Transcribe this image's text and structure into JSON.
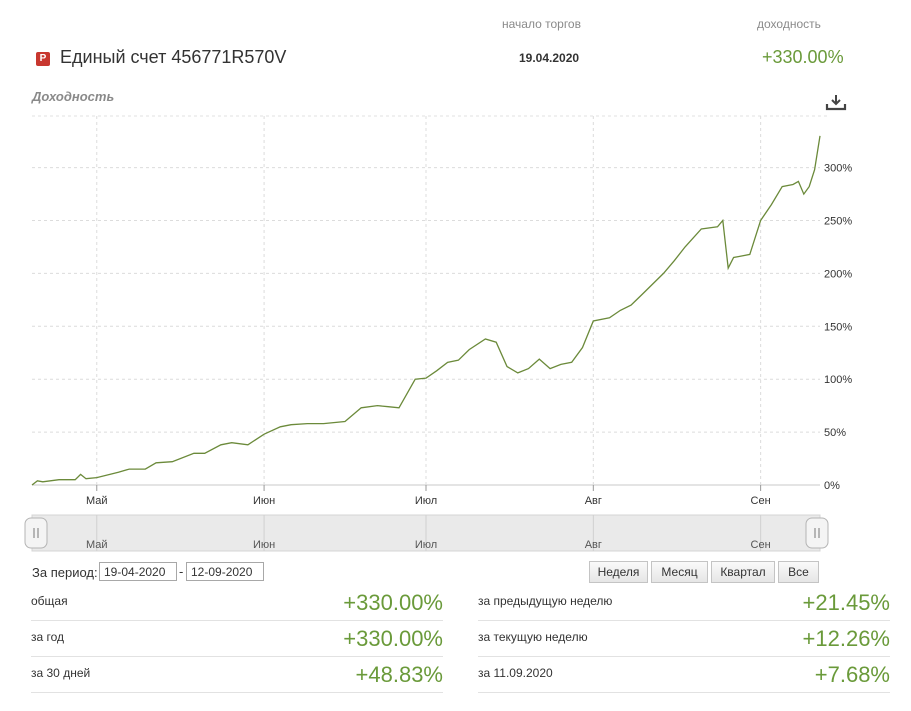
{
  "header": {
    "start_label": "начало торгов",
    "yield_label": "доходность",
    "badge": "P",
    "account_title": "Единый счет 456771R570V",
    "start_date": "19.04.2020",
    "total_yield": "+330.00%"
  },
  "chart_title": "Доходность",
  "download_icon": "download-icon",
  "chart_data": {
    "type": "line",
    "title": "Доходность",
    "x_labels": [
      "Май",
      "Июн",
      "Июл",
      "Авг",
      "Сен"
    ],
    "x_label_dates": [
      "2020-05-01",
      "2020-06-01",
      "2020-07-01",
      "2020-08-01",
      "2020-09-01"
    ],
    "x_range": [
      "2020-04-19",
      "2020-09-12"
    ],
    "y_ticks": [
      0,
      50,
      100,
      150,
      200,
      250,
      300
    ],
    "y_tick_labels": [
      "0%",
      "50%",
      "100%",
      "150%",
      "200%",
      "250%",
      "300%"
    ],
    "ylim": [
      0,
      350
    ],
    "grid": true,
    "line_color": "#6b8a3a",
    "series": [
      {
        "x": [
          "2020-04-19",
          "2020-04-20",
          "2020-04-21",
          "2020-04-24",
          "2020-04-27",
          "2020-04-28",
          "2020-04-29",
          "2020-05-01",
          "2020-05-05",
          "2020-05-07",
          "2020-05-10",
          "2020-05-12",
          "2020-05-15",
          "2020-05-19",
          "2020-05-21",
          "2020-05-24",
          "2020-05-26",
          "2020-05-29",
          "2020-06-01",
          "2020-06-04",
          "2020-06-06",
          "2020-06-09",
          "2020-06-12",
          "2020-06-16",
          "2020-06-19",
          "2020-06-22",
          "2020-06-24",
          "2020-06-26",
          "2020-06-29",
          "2020-07-01",
          "2020-07-03",
          "2020-07-05",
          "2020-07-07",
          "2020-07-09",
          "2020-07-12",
          "2020-07-14",
          "2020-07-16",
          "2020-07-18",
          "2020-07-20",
          "2020-07-22",
          "2020-07-24",
          "2020-07-26",
          "2020-07-28",
          "2020-07-30",
          "2020-08-01",
          "2020-08-04",
          "2020-08-06",
          "2020-08-08",
          "2020-08-10",
          "2020-08-12",
          "2020-08-14",
          "2020-08-16",
          "2020-08-18",
          "2020-08-21",
          "2020-08-24",
          "2020-08-25",
          "2020-08-26",
          "2020-08-27",
          "2020-08-28",
          "2020-08-30",
          "2020-09-01",
          "2020-09-03",
          "2020-09-05",
          "2020-09-07",
          "2020-09-08",
          "2020-09-09",
          "2020-09-10",
          "2020-09-11",
          "2020-09-12"
        ],
        "values": [
          0,
          4,
          3,
          5,
          5,
          10,
          6,
          7,
          12,
          15,
          15,
          21,
          22,
          30,
          30,
          38,
          40,
          38,
          48,
          55,
          57,
          58,
          58,
          60,
          73,
          75,
          74,
          73,
          100,
          101,
          108,
          116,
          118,
          128,
          138,
          135,
          112,
          106,
          110,
          119,
          110,
          114,
          116,
          130,
          155,
          158,
          165,
          170,
          180,
          190,
          200,
          212,
          225,
          242,
          244,
          250,
          205,
          215,
          216,
          218,
          250,
          265,
          282,
          284,
          287,
          275,
          282,
          298,
          330
        ]
      }
    ]
  },
  "navigator": {
    "labels": [
      "Май",
      "Июн",
      "Июл",
      "Авг",
      "Сен"
    ],
    "handle_glyph": "||"
  },
  "period": {
    "label": "За период:",
    "from": "19-04-2020",
    "separator": "-",
    "to": "12-09-2020",
    "buttons": [
      "Неделя",
      "Месяц",
      "Квартал",
      "Все"
    ]
  },
  "stats_left": [
    {
      "label": "общая",
      "value": "+330.00%"
    },
    {
      "label": "за год",
      "value": "+330.00%"
    },
    {
      "label": "за 30 дней",
      "value": "+48.83%"
    }
  ],
  "stats_right": [
    {
      "label": "за предыдущую неделю",
      "value": "+21.45%"
    },
    {
      "label": "за текущую неделю",
      "value": "+12.26%"
    },
    {
      "label": "за 11.09.2020",
      "value": "+7.68%"
    }
  ]
}
